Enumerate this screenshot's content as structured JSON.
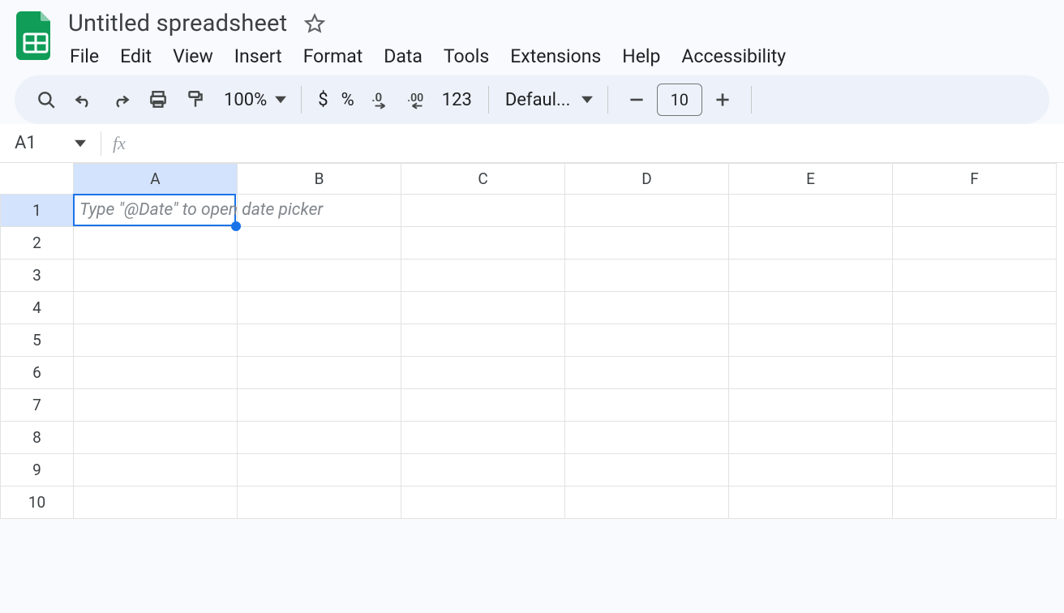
{
  "doc": {
    "title": "Untitled spreadsheet"
  },
  "menubar": [
    "File",
    "Edit",
    "View",
    "Insert",
    "Format",
    "Data",
    "Tools",
    "Extensions",
    "Help",
    "Accessibility"
  ],
  "toolbar": {
    "zoom": "100%",
    "currency": "$",
    "percent": "%",
    "dec_dec": ".0",
    "inc_dec": ".00",
    "more_formats": "123",
    "font": "Defaul...",
    "font_size": "10"
  },
  "namebox": {
    "ref": "A1"
  },
  "formula": {
    "symbol": "fx"
  },
  "grid": {
    "cols": [
      "A",
      "B",
      "C",
      "D",
      "E",
      "F"
    ],
    "rows": [
      "1",
      "2",
      "3",
      "4",
      "5",
      "6",
      "7",
      "8",
      "9",
      "10"
    ],
    "selected": "A1",
    "hint": "Type \"@Date\" to open date picker"
  }
}
